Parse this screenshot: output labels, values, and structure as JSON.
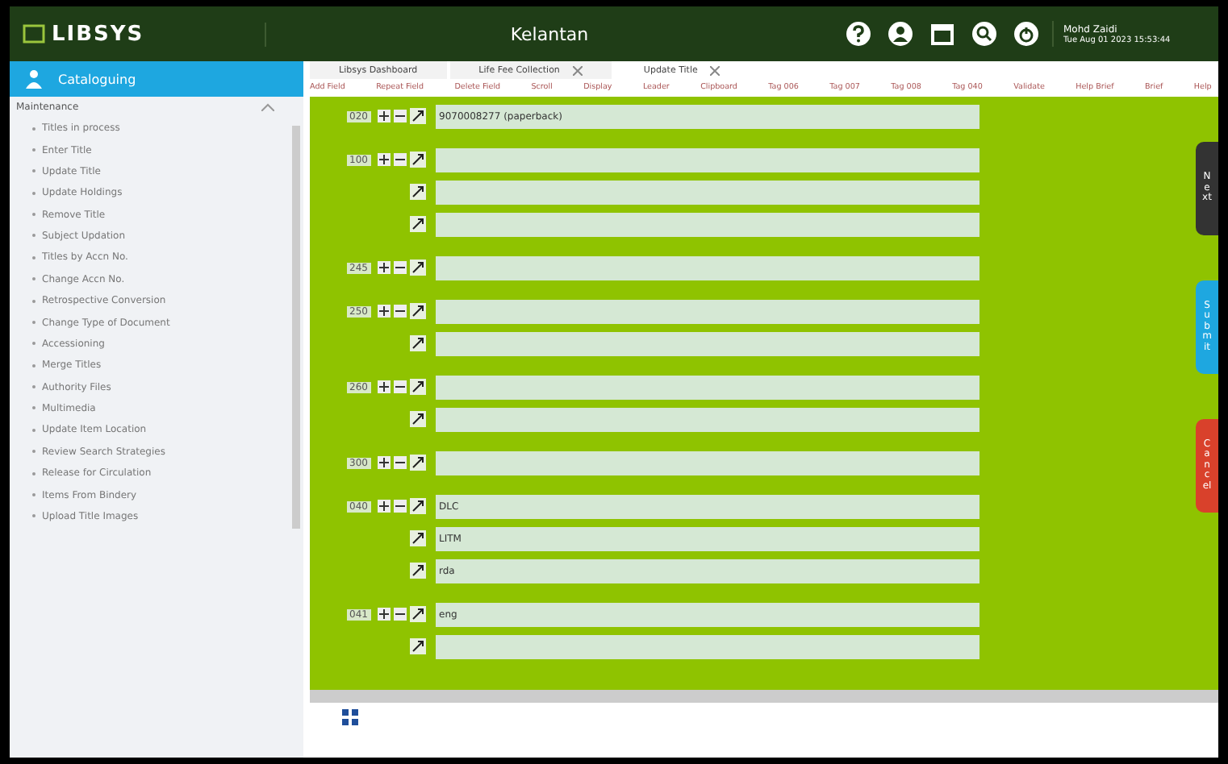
{
  "header": {
    "logo": "LIBSYS",
    "location": "Kelantan",
    "user_name": "Mohd Zaidi",
    "datetime": "Tue Aug 01 2023 15:53:44"
  },
  "sidebar": {
    "module": "Cataloguing",
    "section": {
      "title": "Maintenance",
      "expanded": true,
      "items": [
        "Titles in process",
        "Enter Title",
        "Update Title",
        "Update Holdings",
        "Remove Title",
        "Subject Updation",
        "Titles by Accn No.",
        "Change Accn No.",
        "Retrospective Conversion",
        "Change Type of Document",
        "Accessioning",
        "Merge Titles",
        "Authority Files",
        "Multimedia",
        "Update Item Location",
        "Review Search Strategies",
        "Release for Circulation",
        "Items From Bindery",
        "Upload Title Images"
      ]
    }
  },
  "tabs": [
    {
      "label": "Libsys Dashboard",
      "closable": false,
      "selected": false
    },
    {
      "label": "Life Fee Collection",
      "closable": true,
      "selected": false
    },
    {
      "label": "Update Title",
      "closable": true,
      "selected": true
    }
  ],
  "toolbar": [
    "Add Field",
    "Repeat Field",
    "Delete Field",
    "Scroll",
    "Display",
    "Leader",
    "Clipboard",
    "Tag 006",
    "Tag 007",
    "Tag 008",
    "Tag 040",
    "Validate",
    "Help Brief",
    "Brief",
    "Help"
  ],
  "fields": [
    {
      "tag": "020",
      "subfields": [
        {
          "kind": "text",
          "value": "9070008277 (paperback)"
        }
      ]
    },
    {
      "tag": "100",
      "subfields": [
        {
          "kind": "blank"
        },
        {
          "kind": "blank"
        },
        {
          "kind": "blank"
        }
      ]
    },
    {
      "tag": "245",
      "subfields": [
        {
          "kind": "blank"
        }
      ]
    },
    {
      "tag": "250",
      "subfields": [
        {
          "kind": "blank"
        },
        {
          "kind": "blank"
        }
      ]
    },
    {
      "tag": "260",
      "subfields": [
        {
          "kind": "blank"
        },
        {
          "kind": "blank"
        }
      ]
    },
    {
      "tag": "300",
      "subfields": [
        {
          "kind": "blank"
        }
      ]
    },
    {
      "tag": "040",
      "subfields": [
        {
          "kind": "text",
          "value": "DLC"
        },
        {
          "kind": "text",
          "value": "LITM"
        },
        {
          "kind": "text",
          "value": "rda"
        }
      ]
    },
    {
      "tag": "041",
      "subfields": [
        {
          "kind": "text",
          "value": "eng"
        },
        {
          "kind": "blank"
        }
      ]
    }
  ],
  "side_tabs": [
    {
      "label": "Next",
      "color": "#333333"
    },
    {
      "label": "Submit",
      "color": "#1ea7e0"
    },
    {
      "label": "Cancel",
      "color": "#d9412b"
    }
  ]
}
